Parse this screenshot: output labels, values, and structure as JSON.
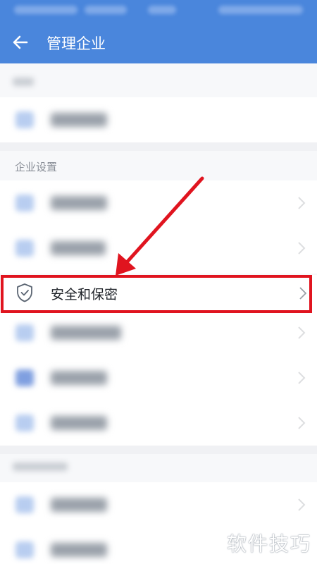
{
  "header": {
    "title": "管理企业",
    "back_icon": "arrow-left-icon"
  },
  "sections": {
    "enterprise_settings": "企业设置"
  },
  "highlighted_item": {
    "label": "安全和保密",
    "icon": "shield-check-icon"
  },
  "watermark": "软件技巧",
  "colors": {
    "brand": "#4a86dc",
    "highlight": "#e0141f"
  }
}
